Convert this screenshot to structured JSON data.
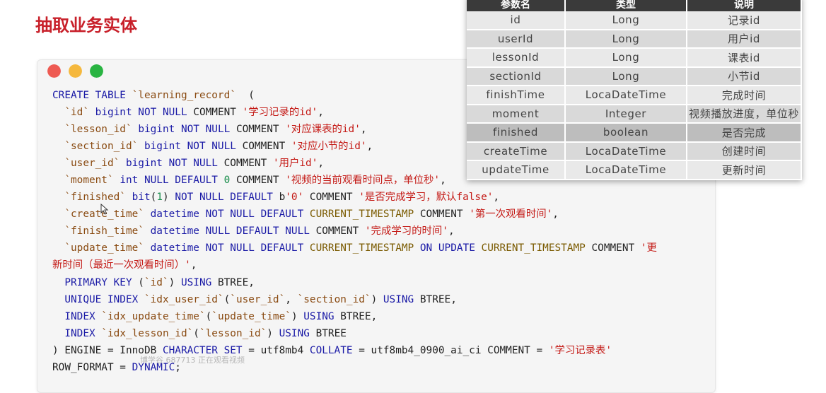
{
  "page": {
    "title": "抽取业务实体"
  },
  "window": {
    "controls": [
      {
        "name": "close-dot",
        "color": "#ee5a52"
      },
      {
        "name": "minimize-dot",
        "color": "#f5b83d"
      },
      {
        "name": "zoom-dot",
        "color": "#29b442"
      }
    ]
  },
  "code": {
    "lines": [
      [
        [
          "kw",
          "CREATE TABLE "
        ],
        [
          "id",
          "`learning_record`"
        ],
        [
          "p",
          "  ("
        ]
      ],
      [
        [
          "p",
          "  "
        ],
        [
          "id",
          "`id`"
        ],
        [
          "p",
          " "
        ],
        [
          "kw",
          "bigint NOT NULL"
        ],
        [
          "p",
          " COMMENT "
        ],
        [
          "str",
          "'学习记录的id'"
        ],
        [
          "p",
          ","
        ]
      ],
      [
        [
          "p",
          "  "
        ],
        [
          "id",
          "`lesson_id`"
        ],
        [
          "p",
          " "
        ],
        [
          "kw",
          "bigint NOT NULL"
        ],
        [
          "p",
          " COMMENT "
        ],
        [
          "str",
          "'对应课表的id'"
        ],
        [
          "p",
          ","
        ]
      ],
      [
        [
          "p",
          "  "
        ],
        [
          "id",
          "`section_id`"
        ],
        [
          "p",
          " "
        ],
        [
          "kw",
          "bigint NOT NULL"
        ],
        [
          "p",
          " COMMENT "
        ],
        [
          "str",
          "'对应小节的id'"
        ],
        [
          "p",
          ","
        ]
      ],
      [
        [
          "p",
          "  "
        ],
        [
          "id",
          "`user_id`"
        ],
        [
          "p",
          " "
        ],
        [
          "kw",
          "bigint NOT NULL"
        ],
        [
          "p",
          " COMMENT "
        ],
        [
          "str",
          "'用户id'"
        ],
        [
          "p",
          ","
        ]
      ],
      [
        [
          "p",
          "  "
        ],
        [
          "id",
          "`moment`"
        ],
        [
          "p",
          " "
        ],
        [
          "kw",
          "int NULL DEFAULT"
        ],
        [
          "p",
          " "
        ],
        [
          "num",
          "0"
        ],
        [
          "p",
          " COMMENT "
        ],
        [
          "str",
          "'视频的当前观看时间点，单位秒'"
        ],
        [
          "p",
          ","
        ]
      ],
      [
        [
          "p",
          "  "
        ],
        [
          "id",
          "`finished`"
        ],
        [
          "p",
          " "
        ],
        [
          "kw",
          "bit"
        ],
        [
          "p",
          "("
        ],
        [
          "num",
          "1"
        ],
        [
          "p",
          ") "
        ],
        [
          "kw",
          "NOT NULL DEFAULT"
        ],
        [
          "p",
          " b"
        ],
        [
          "str",
          "'0'"
        ],
        [
          "p",
          " COMMENT "
        ],
        [
          "str",
          "'是否完成学习，默认false'"
        ],
        [
          "p",
          ","
        ]
      ],
      [
        [
          "p",
          "  "
        ],
        [
          "id",
          "`create_time`"
        ],
        [
          "p",
          " "
        ],
        [
          "kw",
          "datetime NOT NULL DEFAULT"
        ],
        [
          "p",
          " "
        ],
        [
          "fn",
          "CURRENT_TIMESTAMP"
        ],
        [
          "p",
          " COMMENT "
        ],
        [
          "str",
          "'第一次观看时间'"
        ],
        [
          "p",
          ","
        ]
      ],
      [
        [
          "p",
          "  "
        ],
        [
          "id",
          "`finish_time`"
        ],
        [
          "p",
          " "
        ],
        [
          "kw",
          "datetime NULL DEFAULT NULL"
        ],
        [
          "p",
          " COMMENT "
        ],
        [
          "str",
          "'完成学习的时间'"
        ],
        [
          "p",
          ","
        ]
      ],
      [
        [
          "p",
          "  "
        ],
        [
          "id",
          "`update_time`"
        ],
        [
          "p",
          " "
        ],
        [
          "kw",
          "datetime NOT NULL DEFAULT"
        ],
        [
          "p",
          " "
        ],
        [
          "fn",
          "CURRENT_TIMESTAMP"
        ],
        [
          "p",
          " "
        ],
        [
          "kw",
          "ON UPDATE"
        ],
        [
          "p",
          " "
        ],
        [
          "fn",
          "CURRENT_TIMESTAMP"
        ],
        [
          "p",
          " COMMENT "
        ],
        [
          "str",
          "'更"
        ]
      ],
      [
        [
          "str",
          "新时间（最近一次观看时间）'"
        ],
        [
          "p",
          ","
        ]
      ],
      [
        [
          "p",
          "  "
        ],
        [
          "kw",
          "PRIMARY KEY"
        ],
        [
          "p",
          " ("
        ],
        [
          "id",
          "`id`"
        ],
        [
          "p",
          ") "
        ],
        [
          "kw",
          "USING"
        ],
        [
          "p",
          " BTREE,"
        ]
      ],
      [
        [
          "p",
          "  "
        ],
        [
          "kw",
          "UNIQUE INDEX"
        ],
        [
          "p",
          " "
        ],
        [
          "id",
          "`idx_user_id`"
        ],
        [
          "p",
          "("
        ],
        [
          "id",
          "`user_id`"
        ],
        [
          "p",
          ", "
        ],
        [
          "id",
          "`section_id`"
        ],
        [
          "p",
          ") "
        ],
        [
          "kw",
          "USING"
        ],
        [
          "p",
          " BTREE,"
        ]
      ],
      [
        [
          "p",
          "  "
        ],
        [
          "kw",
          "INDEX"
        ],
        [
          "p",
          " "
        ],
        [
          "id",
          "`idx_update_time`"
        ],
        [
          "p",
          "("
        ],
        [
          "id",
          "`update_time`"
        ],
        [
          "p",
          ") "
        ],
        [
          "kw",
          "USING"
        ],
        [
          "p",
          " BTREE,"
        ]
      ],
      [
        [
          "p",
          "  "
        ],
        [
          "kw",
          "INDEX"
        ],
        [
          "p",
          " "
        ],
        [
          "id",
          "`idx_lesson_id`"
        ],
        [
          "p",
          "("
        ],
        [
          "id",
          "`lesson_id`"
        ],
        [
          "p",
          ") "
        ],
        [
          "kw",
          "USING"
        ],
        [
          "p",
          " BTREE"
        ]
      ],
      [
        [
          "p",
          ") ENGINE = InnoDB "
        ],
        [
          "kw",
          "CHARACTER SET"
        ],
        [
          "p",
          " = utf8mb4 "
        ],
        [
          "kw",
          "COLLATE"
        ],
        [
          "p",
          " = utf8mb4_0900_ai_ci COMMENT = "
        ],
        [
          "str",
          "'学习记录表'"
        ]
      ],
      [
        [
          "p",
          "ROW_FORMAT = "
        ],
        [
          "kw",
          "DYNAMIC"
        ],
        [
          "p",
          ";"
        ]
      ]
    ]
  },
  "field_table": {
    "headers": [
      "参数名",
      "类型",
      "说明"
    ],
    "rows": [
      [
        "id",
        "Long",
        "记录id"
      ],
      [
        "userId",
        "Long",
        "用户id"
      ],
      [
        "lessonId",
        "Long",
        "课表id"
      ],
      [
        "sectionId",
        "Long",
        "小节id"
      ],
      [
        "finishTime",
        "LocaDateTime",
        "完成时间"
      ],
      [
        "moment",
        "Integer",
        "视频播放进度，单位秒"
      ],
      [
        "finished",
        "boolean",
        "是否完成"
      ],
      [
        "createTime",
        "LocaDateTime",
        "创建时间"
      ],
      [
        "updateTime",
        "LocaDateTime",
        "更新时间"
      ]
    ]
  },
  "watermark": {
    "text": "博学谷 687713 正在观看视频"
  }
}
